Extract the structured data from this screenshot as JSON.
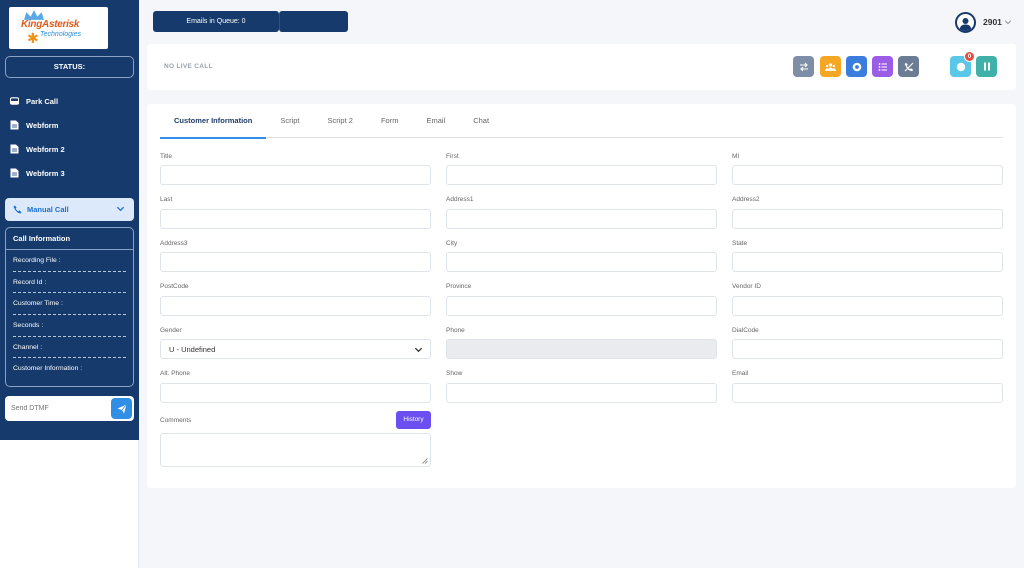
{
  "sidebar": {
    "logo": {
      "name": "KingAsterisk",
      "sub": "Technologies"
    },
    "status_label": "STATUS:",
    "nav": [
      {
        "label": "Park Call",
        "icon": "park-call-icon"
      },
      {
        "label": "Webform",
        "icon": "document-icon"
      },
      {
        "label": "Webform 2",
        "icon": "document-icon"
      },
      {
        "label": "Webform 3",
        "icon": "document-icon"
      }
    ],
    "manual_call": {
      "label": "Manual Call",
      "icon": "phone-icon"
    },
    "call_info": {
      "title": "Call Information",
      "rows": [
        "Recording File :",
        "Record Id :",
        "Customer Time :",
        "Seconds :",
        "Channel :",
        "Customer Information :"
      ]
    },
    "dtmf": {
      "placeholder": "Send DTMF",
      "icon": "send-icon"
    }
  },
  "topbar": {
    "emails_in_queue": "Emails in Queue: 0",
    "user_id": "2901",
    "user_icon": "user-avatar-icon"
  },
  "live_call": {
    "status": "NO LIVE CALL",
    "actions": [
      {
        "name": "transfer-button",
        "icon": "transfer-icon",
        "color": "#7e8ea6"
      },
      {
        "name": "conference-button",
        "icon": "users-icon",
        "color": "#f5a623"
      },
      {
        "name": "record-button",
        "icon": "record-icon",
        "color": "#3b7ddd"
      },
      {
        "name": "list-button",
        "icon": "list-icon",
        "color": "#9b5de5"
      },
      {
        "name": "hangup-button",
        "icon": "phone-slash-icon",
        "color": "#6b7c94"
      }
    ],
    "right_actions": [
      {
        "name": "status-button",
        "icon": "circle-icon",
        "color": "#5bc7e8",
        "badge": "0"
      },
      {
        "name": "pause-button",
        "icon": "pause-icon",
        "color": "#3fb1a8"
      }
    ]
  },
  "tabs": [
    "Customer Information",
    "Script",
    "Script 2",
    "Form",
    "Email",
    "Chat"
  ],
  "form": {
    "labels": {
      "title": "Title",
      "first": "First",
      "mi": "MI",
      "last": "Last",
      "address1": "Address1",
      "address2": "Address2",
      "address3": "Address3",
      "city": "City",
      "state": "State",
      "postcode": "PostCode",
      "province": "Province",
      "vendor_id": "Vendor ID",
      "gender": "Gender",
      "phone": "Phone",
      "dialcode": "DialCode",
      "alt_phone": "Alt. Phone",
      "show": "Show",
      "email": "Email",
      "comments": "Comments"
    },
    "gender_value": "U - Undefined",
    "history_label": "History"
  }
}
